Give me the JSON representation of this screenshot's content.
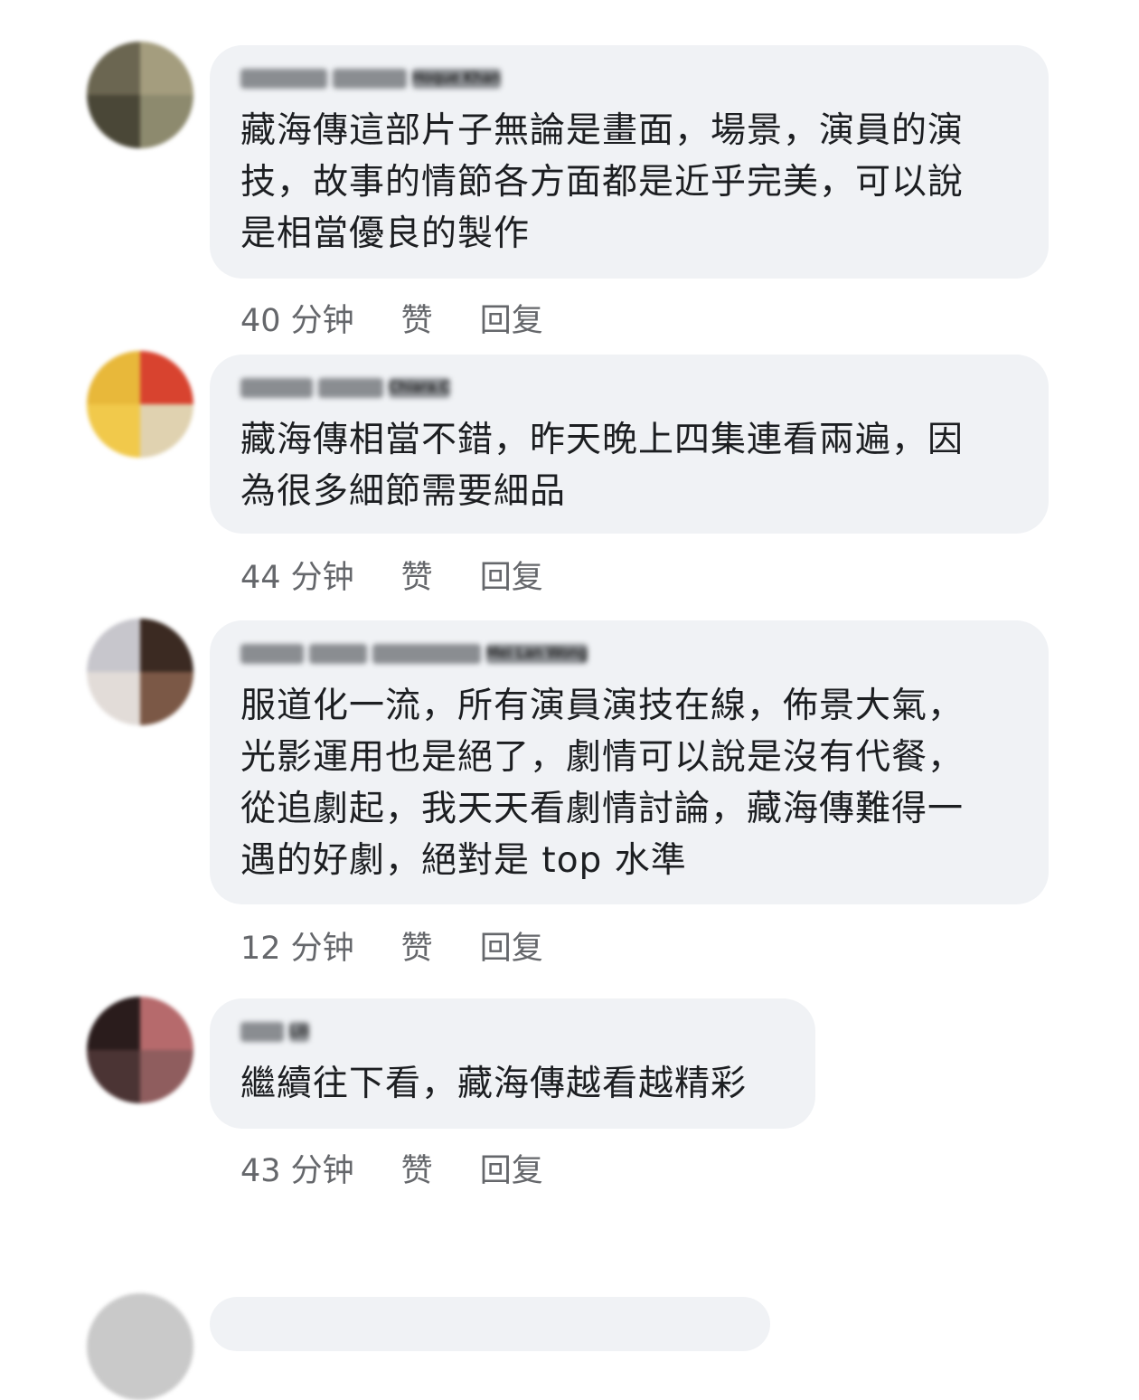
{
  "comments": [
    {
      "author": "Hoque Khan",
      "text": "藏海傳這部片子無論是畫面，場景，演員的演\n技，故事的情節各方面都是近乎完美，可以說\n是相當優良的製作",
      "time": "40 分钟",
      "like_label": "赞",
      "reply_label": "回复",
      "avatar_colors": [
        "#6b6651",
        "#a49d7e",
        "#4a4737",
        "#8d8a6e"
      ]
    },
    {
      "author": "Chiara.C",
      "text": "藏海傳相當不錯，昨天晚上四集連看兩遍，因\n為很多細節需要細品",
      "time": "44 分钟",
      "like_label": "赞",
      "reply_label": "回复",
      "avatar_colors": [
        "#e8b83a",
        "#d8432f",
        "#f1c94b",
        "#e0d2b0"
      ]
    },
    {
      "author": "Mei Lan Wong",
      "text": "服道化一流，所有演員演技在線，佈景大氣，\n光影運用也是絕了，劇情可以說是沒有代餐，\n從追劇起，我天天看劇情討論，藏海傳難得一\n遇的好劇，絕對是 top 水準",
      "time": "12 分钟",
      "like_label": "赞",
      "reply_label": "回复",
      "avatar_colors": [
        "#c7c6cc",
        "#3b2a22",
        "#e2dcd8",
        "#7b5846"
      ]
    },
    {
      "author": "Lili",
      "text": "繼續往下看，藏海傳越看越精彩",
      "time": "43 分钟",
      "like_label": "赞",
      "reply_label": "回复",
      "avatar_colors": [
        "#2a1c1c",
        "#b66a6c",
        "#4b3434",
        "#8f5d5e"
      ]
    }
  ]
}
